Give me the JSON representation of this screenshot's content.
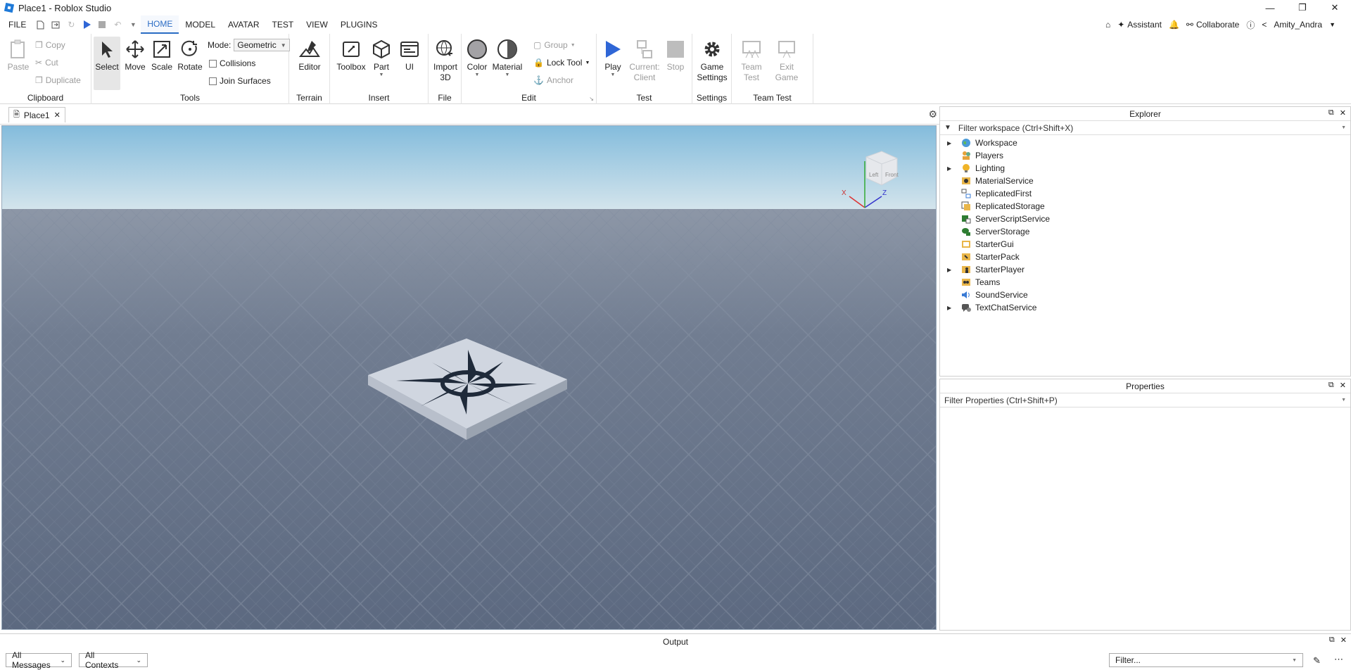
{
  "window": {
    "title": "Place1 - Roblox Studio"
  },
  "menu": {
    "file": "FILE",
    "tabs": [
      {
        "label": "HOME",
        "active": true
      },
      {
        "label": "MODEL"
      },
      {
        "label": "AVATAR"
      },
      {
        "label": "TEST"
      },
      {
        "label": "VIEW"
      },
      {
        "label": "PLUGINS"
      }
    ],
    "assistant": "Assistant",
    "collaborate": "Collaborate",
    "user": "Amity_Andra"
  },
  "ribbon": {
    "clipboard": {
      "title": "Clipboard",
      "paste": "Paste",
      "copy": "Copy",
      "cut": "Cut",
      "duplicate": "Duplicate"
    },
    "tools": {
      "title": "Tools",
      "select": "Select",
      "move": "Move",
      "scale": "Scale",
      "rotate": "Rotate",
      "mode_label": "Mode:",
      "mode_value": "Geometric",
      "collisions": "Collisions",
      "join_surfaces": "Join Surfaces"
    },
    "terrain": {
      "title": "Terrain",
      "editor": "Editor"
    },
    "insert": {
      "title": "Insert",
      "toolbox": "Toolbox",
      "part": "Part",
      "ui": "UI"
    },
    "file": {
      "title": "File",
      "import_3d_line1": "Import",
      "import_3d_line2": "3D"
    },
    "edit": {
      "title": "Edit",
      "color": "Color",
      "material": "Material",
      "group": "Group",
      "lock_tool": "Lock Tool",
      "anchor": "Anchor"
    },
    "test": {
      "title": "Test",
      "play": "Play",
      "current_line1": "Current:",
      "current_line2": "Client",
      "stop": "Stop"
    },
    "settings": {
      "title": "Settings",
      "game_settings_line1": "Game",
      "game_settings_line2": "Settings"
    },
    "team_test": {
      "title": "Team Test",
      "team_test_line1": "Team",
      "team_test_line2": "Test",
      "exit_game_line1": "Exit",
      "exit_game_line2": "Game"
    }
  },
  "doc_tab": {
    "label": "Place1"
  },
  "explorer": {
    "title": "Explorer",
    "filter_placeholder": "Filter workspace (Ctrl+Shift+X)",
    "items": [
      {
        "label": "Workspace",
        "expandable": true
      },
      {
        "label": "Players",
        "expandable": false
      },
      {
        "label": "Lighting",
        "expandable": true
      },
      {
        "label": "MaterialService",
        "expandable": false
      },
      {
        "label": "ReplicatedFirst",
        "expandable": false
      },
      {
        "label": "ReplicatedStorage",
        "expandable": false
      },
      {
        "label": "ServerScriptService",
        "expandable": false
      },
      {
        "label": "ServerStorage",
        "expandable": false
      },
      {
        "label": "StarterGui",
        "expandable": false
      },
      {
        "label": "StarterPack",
        "expandable": false
      },
      {
        "label": "StarterPlayer",
        "expandable": true
      },
      {
        "label": "Teams",
        "expandable": false
      },
      {
        "label": "SoundService",
        "expandable": false
      },
      {
        "label": "TextChatService",
        "expandable": true
      }
    ]
  },
  "properties": {
    "title": "Properties",
    "filter_placeholder": "Filter Properties (Ctrl+Shift+P)"
  },
  "output": {
    "title": "Output",
    "messages": "All Messages",
    "contexts": "All Contexts",
    "filter_placeholder": "Filter..."
  },
  "viewport": {
    "gizmo_x": "X",
    "gizmo_z": "Z",
    "gizmo_face_left": "Left",
    "gizmo_face_front": "Front"
  },
  "colors": {
    "accent": "#2a6cc4",
    "play": "#2f66d6",
    "sky_top": "#8cc3e0",
    "ground": "#66748a"
  }
}
